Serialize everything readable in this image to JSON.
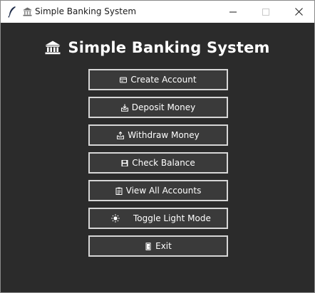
{
  "window": {
    "title": "Simple Banking System"
  },
  "header": {
    "title": "Simple Banking System",
    "icon": "bank-icon"
  },
  "menu": {
    "create_account": {
      "label": "Create Account",
      "icon": "card-icon"
    },
    "deposit_money": {
      "label": "Deposit Money",
      "icon": "inbox-tray-icon"
    },
    "withdraw_money": {
      "label": "Withdraw Money",
      "icon": "outbox-tray-icon"
    },
    "check_balance": {
      "label": "Check Balance",
      "icon": "save-icon"
    },
    "view_all_accounts": {
      "label": "View All Accounts",
      "icon": "clipboard-icon"
    },
    "toggle_light_mode": {
      "label": "Toggle Light Mode",
      "icon": "sun-icon"
    },
    "exit": {
      "label": "Exit",
      "icon": "door-icon"
    }
  },
  "colors": {
    "background": "#2b2b2b",
    "button_bg": "#3a3a3a",
    "button_border": "#d6d6d6",
    "text": "#ffffff"
  }
}
